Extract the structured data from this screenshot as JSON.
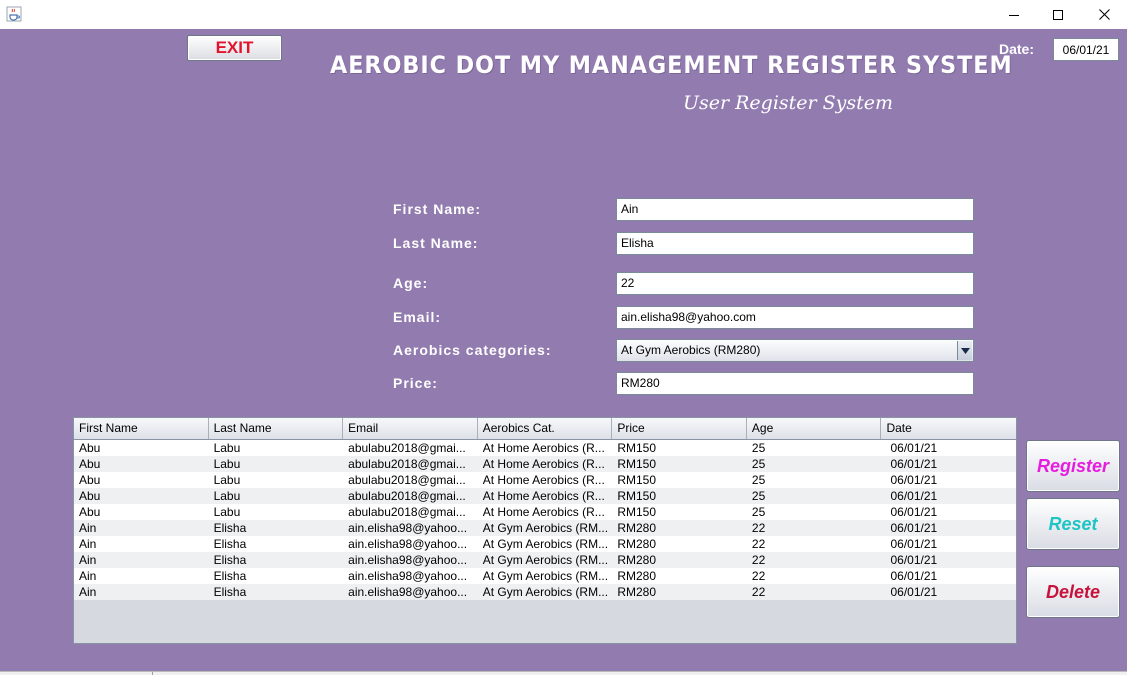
{
  "window": {
    "icon": "java-cup-icon",
    "controls": [
      "minimize-icon",
      "maximize-icon",
      "close-icon"
    ]
  },
  "header": {
    "exit_label": "EXIT",
    "title": "AEROBIC DOT MY MANAGEMENT REGISTER SYSTEM",
    "subtitle": "User Register System",
    "date_label": "Date:",
    "date_value": "06/01/21"
  },
  "form": {
    "first_name_label": "First Name:",
    "first_name_value": "Ain",
    "last_name_label": "Last Name:",
    "last_name_value": "Elisha",
    "age_label": "Age:",
    "age_value": "22",
    "email_label": "Email:",
    "email_value": "ain.elisha98@yahoo.com",
    "category_label": "Aerobics categories:",
    "category_value": "At Gym Aerobics (RM280)",
    "price_label": "Price:",
    "price_value": "RM280"
  },
  "table": {
    "columns": [
      "First Name",
      "Last Name",
      "Email",
      "Aerobics Cat.",
      "Price",
      "Age",
      "Date"
    ],
    "rows": [
      [
        "Abu",
        "Labu",
        "abulabu2018@gmai...",
        "At Home Aerobics (R...",
        "RM150",
        "25",
        "06/01/21"
      ],
      [
        "Abu",
        "Labu",
        "abulabu2018@gmai...",
        "At Home Aerobics (R...",
        "RM150",
        "25",
        "06/01/21"
      ],
      [
        "Abu",
        "Labu",
        "abulabu2018@gmai...",
        "At Home Aerobics (R...",
        "RM150",
        "25",
        "06/01/21"
      ],
      [
        "Abu",
        "Labu",
        "abulabu2018@gmai...",
        "At Home Aerobics (R...",
        "RM150",
        "25",
        "06/01/21"
      ],
      [
        "Abu",
        "Labu",
        "abulabu2018@gmai...",
        "At Home Aerobics (R...",
        "RM150",
        "25",
        "06/01/21"
      ],
      [
        "Ain",
        "Elisha",
        "ain.elisha98@yahoo...",
        "At Gym Aerobics (RM...",
        "RM280",
        "22",
        "06/01/21"
      ],
      [
        "Ain",
        "Elisha",
        "ain.elisha98@yahoo...",
        "At Gym Aerobics (RM...",
        "RM280",
        "22",
        "06/01/21"
      ],
      [
        "Ain",
        "Elisha",
        "ain.elisha98@yahoo...",
        "At Gym Aerobics (RM...",
        "RM280",
        "22",
        "06/01/21"
      ],
      [
        "Ain",
        "Elisha",
        "ain.elisha98@yahoo...",
        "At Gym Aerobics (RM...",
        "RM280",
        "22",
        "06/01/21"
      ],
      [
        "Ain",
        "Elisha",
        "ain.elisha98@yahoo...",
        "At Gym Aerobics (RM...",
        "RM280",
        "22",
        "06/01/21"
      ]
    ]
  },
  "actions": {
    "register_label": "Register",
    "reset_label": "Reset",
    "delete_label": "Delete"
  },
  "colors": {
    "background": "#927caf",
    "exit_text": "#e2142d",
    "register_text": "#e51ddf",
    "reset_text": "#1fc4c4",
    "delete_text": "#c8123e"
  }
}
